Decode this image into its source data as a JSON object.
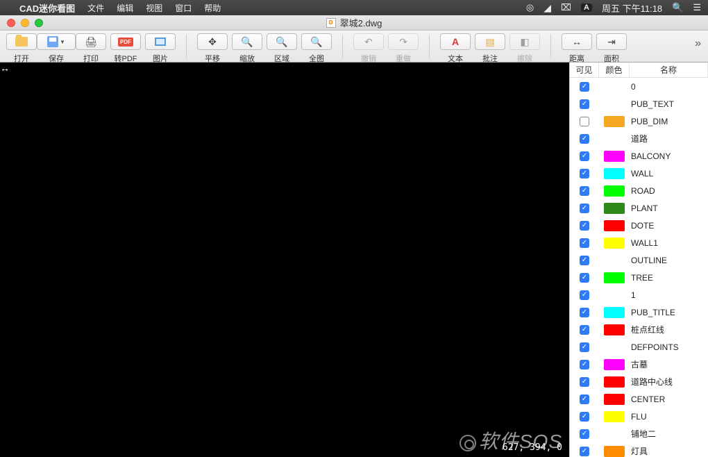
{
  "menubar": {
    "app_name": "CAD迷你看图",
    "items": [
      "文件",
      "编辑",
      "视图",
      "窗口",
      "帮助"
    ],
    "clock": "周五 下午11:18",
    "input_badge": "A"
  },
  "window": {
    "title": "翠城2.dwg"
  },
  "toolbar": {
    "open": "打开",
    "save": "保存",
    "print": "打印",
    "pdf": "转PDF",
    "image": "图片",
    "pan": "平移",
    "zoom": "缩放",
    "region": "区域",
    "fit": "全图",
    "undo": "撤销",
    "redo": "重做",
    "text": "文本",
    "annotate": "批注",
    "erase": "擦除",
    "distance": "距离",
    "area": "面积"
  },
  "layers_header": {
    "visible": "可见",
    "color": "颜色",
    "name": "名称"
  },
  "layers": [
    {
      "visible": true,
      "color": "",
      "name": "0"
    },
    {
      "visible": true,
      "color": "",
      "name": "PUB_TEXT"
    },
    {
      "visible": false,
      "color": "#f5a623",
      "name": "PUB_DIM"
    },
    {
      "visible": true,
      "color": "",
      "name": "道路"
    },
    {
      "visible": true,
      "color": "#ff00ff",
      "name": "BALCONY"
    },
    {
      "visible": true,
      "color": "#00ffff",
      "name": "WALL"
    },
    {
      "visible": true,
      "color": "#00ff00",
      "name": "ROAD"
    },
    {
      "visible": true,
      "color": "#2e8b1a",
      "name": "PLANT"
    },
    {
      "visible": true,
      "color": "#ff0000",
      "name": "DOTE"
    },
    {
      "visible": true,
      "color": "#ffff00",
      "name": "WALL1"
    },
    {
      "visible": true,
      "color": "",
      "name": "OUTLINE"
    },
    {
      "visible": true,
      "color": "#00ff00",
      "name": "TREE"
    },
    {
      "visible": true,
      "color": "",
      "name": "1"
    },
    {
      "visible": true,
      "color": "#00ffff",
      "name": "PUB_TITLE"
    },
    {
      "visible": true,
      "color": "#ff0000",
      "name": "桩点红线"
    },
    {
      "visible": true,
      "color": "",
      "name": "DEFPOINTS"
    },
    {
      "visible": true,
      "color": "#ff00ff",
      "name": "古墓"
    },
    {
      "visible": true,
      "color": "#ff0000",
      "name": "道路中心线"
    },
    {
      "visible": true,
      "color": "#ff0000",
      "name": "CENTER"
    },
    {
      "visible": true,
      "color": "#ffff00",
      "name": "FLU"
    },
    {
      "visible": true,
      "color": "",
      "name": "铺地二"
    },
    {
      "visible": true,
      "color": "#ff8c00",
      "name": "灯具"
    }
  ],
  "coords": "627, 394, 0",
  "watermark": "软件SOS"
}
